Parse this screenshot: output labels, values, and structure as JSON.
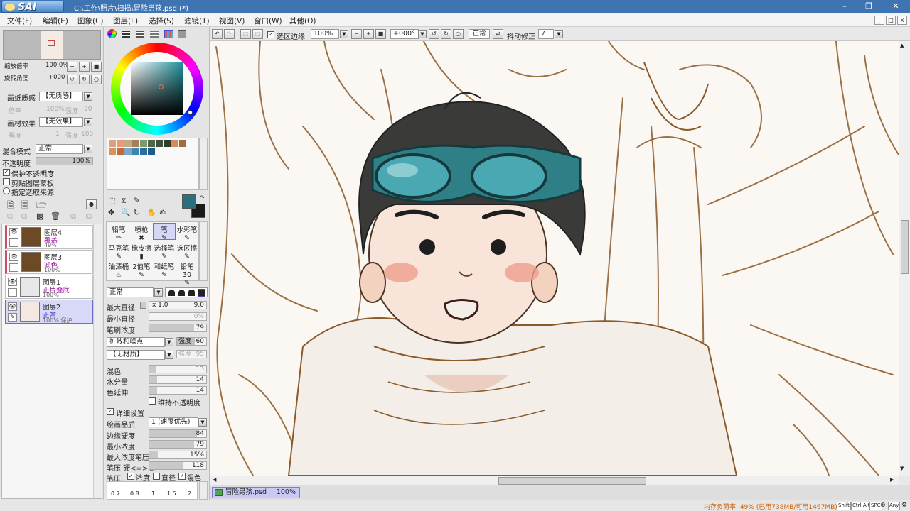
{
  "app": {
    "logo_small": "PaintTool",
    "logo_big": "SAI",
    "title": "C:\\工作\\照片\\扫描\\冒险男孩.psd (*)"
  },
  "menu": [
    "文件(F)",
    "编辑(E)",
    "图象(C)",
    "图层(L)",
    "选择(S)",
    "滤镜(T)",
    "视图(V)",
    "窗口(W)",
    "其他(O)"
  ],
  "navigator": {
    "zoom_label": "缩放倍率",
    "zoom_value": "100.0%",
    "rotate_label": "旋转角度",
    "rotate_value": "+000"
  },
  "paper": {
    "texture_label": "画纸质感",
    "texture_value": "【无质感】",
    "texture_scale_label": "倍率",
    "texture_scale_value": "100%",
    "texture_strength_label": "强度",
    "texture_strength_value": "20",
    "effect_label": "画材效果",
    "effect_value": "【无效果】",
    "effect_width_label": "程度",
    "effect_width_value": "1",
    "effect_strength_label": "强度",
    "effect_strength_value": "100"
  },
  "blend": {
    "mode_label": "混合模式",
    "mode_value": "正常",
    "opacity_label": "不透明度",
    "opacity_value": "100%",
    "opacity_fraction": 1.0,
    "preserve_opacity": "保护不透明度",
    "clip_group": "剪贴图层蒙板",
    "selection_source": "指定选取来源"
  },
  "layers": [
    {
      "name": "图层4",
      "mode": "覆盖",
      "opacity": "49%",
      "color": "#6b4a25"
    },
    {
      "name": "图层3",
      "mode": "滤色",
      "opacity": "100%",
      "color": "#6b4a25"
    },
    {
      "name": "图层1",
      "mode": "正片叠底",
      "opacity": "100%",
      "color": "#e8e8e8"
    },
    {
      "name": "图层2",
      "mode": "正常",
      "opacity": "100% 保护",
      "color": "#f4e8e0"
    }
  ],
  "colors": {
    "primary": "#2b6f7f",
    "secondary": "#1a1a1a",
    "picker_inner": "#3b8a8f"
  },
  "swatches": [
    "#d6a283",
    "#e79b78",
    "#c9a783",
    "#a37f5b",
    "#7d9a6b",
    "#50664b",
    "#3d5237",
    "#2d3d29",
    "#d18a5c",
    "#9e6b3f",
    "#d49460",
    "#c26c33",
    "#7ca8c8",
    "#3f85b2",
    "#2a6e9e",
    "#1f5c86"
  ],
  "tools": {
    "row1": [
      "铅笔",
      "喷枪",
      "笔",
      "水彩笔"
    ],
    "row2": [
      "马克笔",
      "橡皮擦",
      "选择笔",
      "选区擦"
    ],
    "row3": [
      "油漆桶",
      "2值笔",
      "和纸笔",
      "铅笔30"
    ]
  },
  "brush": {
    "mode": "正常",
    "max_size_label": "最大直径",
    "max_size_mult": "x 1.0",
    "max_size_value": "9.0",
    "min_size_label": "最小直径",
    "min_size_value": "0%",
    "density_label": "笔刷浓度",
    "density_value": "79",
    "shape_value": "扩散和噪点",
    "shape_strength_label": "强度",
    "shape_strength_value": "60",
    "texture_value": "【无材质】",
    "texture_strength_label": "强度",
    "texture_strength_value": "95",
    "blending_label": "混色",
    "blending_value": "13",
    "dilution_label": "水分量",
    "dilution_value": "14",
    "persistence_label": "色延伸",
    "persistence_value": "14",
    "keep_opacity": "维持不透明度",
    "advanced_label": "详细设置",
    "quality_label": "绘画品质",
    "quality_value": "1 (速度优先)",
    "edge_label": "边缘硬度",
    "edge_value": "84",
    "min_density_label": "最小浓度",
    "min_density_value": "79",
    "pressure_label": "最大浓度笔压",
    "pressure_value": "15%",
    "hardsoft_label": "笔压 硬<=>软",
    "hardsoft_value": "118",
    "pressure_opts_label": "笔压:",
    "opt_density": "浓度",
    "opt_size": "直径",
    "opt_blend": "混色",
    "size_presets": [
      "0.7",
      "0.8",
      "1",
      "1.5",
      "2"
    ]
  },
  "canvasbar": {
    "sel_edge": "选区边缘",
    "zoom": "100%",
    "angle": "+000°",
    "mode": "正常",
    "stabilizer_label": "抖动修正",
    "stabilizer_value": "7"
  },
  "tab": {
    "file": "冒险男孩.psd",
    "zoom": "100%"
  },
  "status": {
    "memory": "内存负荷率: 49% (已用738MB/可用1467MB)",
    "keys": [
      "Shift",
      "Ctrl",
      "Alt",
      "SPC",
      "Any"
    ]
  }
}
